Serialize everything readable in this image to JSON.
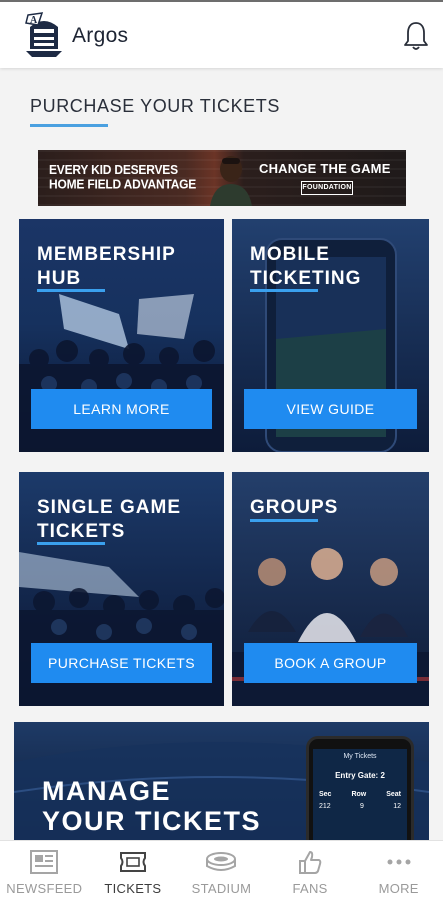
{
  "header": {
    "brand": "Argos"
  },
  "section": {
    "title": "PURCHASE YOUR TICKETS"
  },
  "banner": {
    "left_line1": "EVERY KID DESERVES",
    "left_line2": "HOME FIELD ADVANTAGE",
    "right_text": "CHANGE THE GAME",
    "badge": "FOUNDATION"
  },
  "cards": [
    {
      "title_line1": "MEMBERSHIP",
      "title_line2": "HUB",
      "button": "LEARN MORE"
    },
    {
      "title_line1": "MOBILE",
      "title_line2": "TICKETING",
      "button": "VIEW GUIDE"
    },
    {
      "title_line1": "SINGLE GAME",
      "title_line2": "TICKETS",
      "button": "PURCHASE TICKETS"
    },
    {
      "title_line1": "GROUPS",
      "title_line2": "",
      "button": "BOOK A GROUP"
    }
  ],
  "manage": {
    "title_line1": "MANAGE",
    "title_line2": "YOUR TICKETS",
    "phone": {
      "header": "My Tickets",
      "entry": "Entry Gate: 2",
      "labels": [
        "Sec",
        "Row",
        "Seat"
      ],
      "values": [
        "212",
        "9",
        "12"
      ]
    }
  },
  "bottom_nav": [
    {
      "label": "NEWSFEED",
      "icon": "newsfeed-icon",
      "active": false
    },
    {
      "label": "TICKETS",
      "icon": "tickets-icon",
      "active": true
    },
    {
      "label": "STADIUM",
      "icon": "stadium-icon",
      "active": false
    },
    {
      "label": "FANS",
      "icon": "thumbs-up-icon",
      "active": false
    },
    {
      "label": "MORE",
      "icon": "more-dots-icon",
      "active": false
    }
  ],
  "colors": {
    "accent": "#1f8bf0",
    "underline": "#4aa0e0",
    "navy": "#0e1a33"
  }
}
